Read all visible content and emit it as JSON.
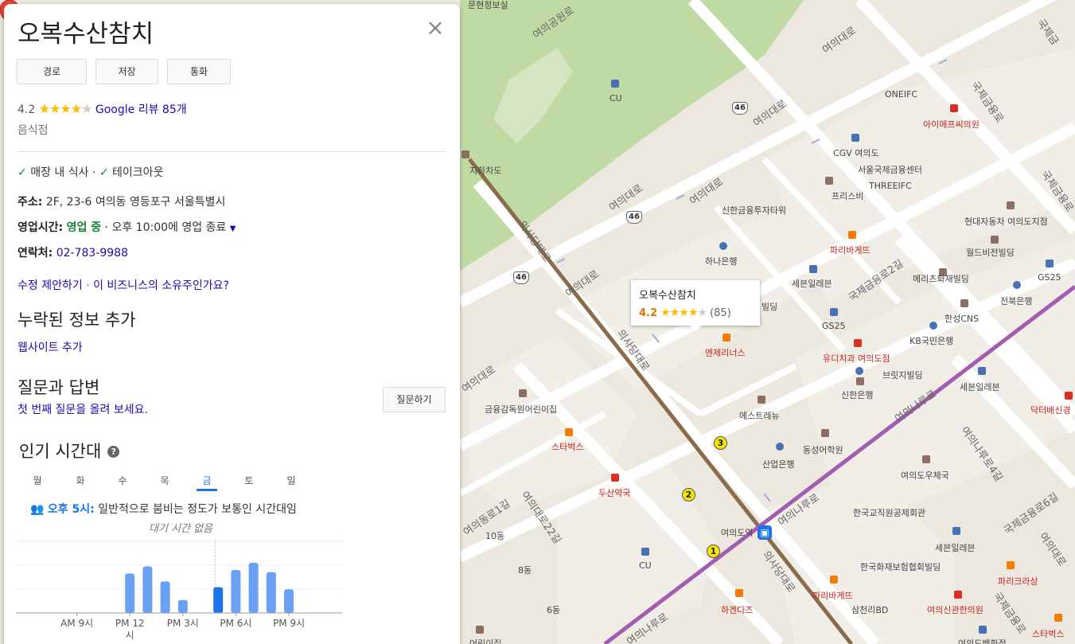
{
  "place": {
    "name": "오복수산참치",
    "actions": [
      "경로",
      "저장",
      "통화"
    ],
    "rating": "4.2",
    "review_link": "Google 리뷰 85개",
    "category": "음식점",
    "services": [
      "매장 내 식사",
      "테이크아웃"
    ],
    "service_sep": "·",
    "address_label": "주소:",
    "address": "2F, 23-6 여의동 영등포구 서울특별시",
    "hours_label": "영업시간:",
    "hours_status": "영업 중",
    "hours_detail": "· 오후 10:00에 영업 종료",
    "phone_label": "연락처:",
    "phone": "02-783-9988",
    "suggest_edit": "수정 제안하기",
    "owner_link": "이 비즈니스의 소유주인가요?",
    "link_sep": "·",
    "missing_title": "누락된 정보 추가",
    "add_website": "웹사이트 추가",
    "qa_title": "질문과 답변",
    "qa_prompt": "첫 번째 질문을 올려 보세요.",
    "ask_button": "질문하기",
    "popular_title": "인기 시간대",
    "help_icon": "?",
    "close_icon": "×"
  },
  "popular_times": {
    "days": [
      "월",
      "화",
      "수",
      "목",
      "금",
      "토",
      "일"
    ],
    "selected_day": "금",
    "time_highlight": "오후 5시:",
    "busy_text": "일반적으로 붐비는 정도가 보통인 시간대임",
    "wait_text": "대기 시간 없음",
    "colors": {
      "bar": "#6aa1f5",
      "current": "#1a73e8"
    }
  },
  "chart_data": {
    "type": "bar",
    "tick_labels": [
      "AM 9시",
      "PM 12\n시",
      "PM 3시",
      "PM 6시",
      "PM 9시"
    ],
    "hours": [
      18,
      19,
      20,
      21,
      22,
      23,
      24
    ],
    "bars_before": [
      {
        "hour": 12,
        "value": 55
      },
      {
        "hour": 13,
        "value": 65
      },
      {
        "hour": 14,
        "value": 44
      },
      {
        "hour": 15,
        "value": 18
      }
    ],
    "bars_after": [
      {
        "hour": 17,
        "value": 36,
        "current": true
      },
      {
        "hour": 18,
        "value": 60
      },
      {
        "hour": 19,
        "value": 70
      },
      {
        "hour": 20,
        "value": 57
      },
      {
        "hour": 21,
        "value": 33
      }
    ],
    "ylim": [
      0,
      100
    ]
  },
  "map": {
    "popup_title": "오복수산참치",
    "popup_rating": "4.2",
    "popup_count": "(85)",
    "labels": [
      {
        "text": "문현정보실",
        "cls": ""
      },
      {
        "text": "ONEIFC",
        "cls": ""
      },
      {
        "text": "아이에프씨의원",
        "cls": "red"
      },
      {
        "text": "CGV 여의도",
        "cls": ""
      },
      {
        "text": "서울국제금융센터",
        "cls": ""
      },
      {
        "text": "THREEIFC",
        "cls": ""
      },
      {
        "text": "프리스비",
        "cls": ""
      },
      {
        "text": "CU",
        "cls": ""
      },
      {
        "text": "신한금융투자타워",
        "cls": ""
      },
      {
        "text": "현대자동차 여의도지점",
        "cls": ""
      },
      {
        "text": "파리바게뜨",
        "cls": "red"
      },
      {
        "text": "월드비전빌딩",
        "cls": ""
      },
      {
        "text": "하나은행",
        "cls": ""
      },
      {
        "text": "세븐일레븐",
        "cls": ""
      },
      {
        "text": "메리츠화재빌딩",
        "cls": ""
      },
      {
        "text": "GS25",
        "cls": ""
      },
      {
        "text": "전북은행",
        "cls": ""
      },
      {
        "text": "빌딩",
        "cls": ""
      },
      {
        "text": "GS25",
        "cls": ""
      },
      {
        "text": "한성CNS",
        "cls": ""
      },
      {
        "text": "엔제리너스",
        "cls": "red"
      },
      {
        "text": "유디치과 여의도점",
        "cls": "red"
      },
      {
        "text": "KB국민은행",
        "cls": ""
      },
      {
        "text": "브릿지빌딩",
        "cls": ""
      },
      {
        "text": "신한은행",
        "cls": ""
      },
      {
        "text": "세븐일레븐",
        "cls": ""
      },
      {
        "text": "금융감독원어린이집",
        "cls": ""
      },
      {
        "text": "에스트레뉴",
        "cls": ""
      },
      {
        "text": "닥터배신경",
        "cls": "red"
      },
      {
        "text": "스타벅스",
        "cls": "red"
      },
      {
        "text": "동성어학원",
        "cls": ""
      },
      {
        "text": "산업은행",
        "cls": ""
      },
      {
        "text": "여의도우체국",
        "cls": ""
      },
      {
        "text": "두산약국",
        "cls": "red"
      },
      {
        "text": "한국교직원공제회관",
        "cls": ""
      },
      {
        "text": "여의도역",
        "cls": ""
      },
      {
        "text": "10동",
        "cls": ""
      },
      {
        "text": "세븐일레븐",
        "cls": ""
      },
      {
        "text": "CU",
        "cls": ""
      },
      {
        "text": "8동",
        "cls": ""
      },
      {
        "text": "한국화재보험협회빌딩",
        "cls": ""
      },
      {
        "text": "파리크라상",
        "cls": "red"
      },
      {
        "text": "파리바게뜨",
        "cls": "red"
      },
      {
        "text": "하겐다즈",
        "cls": "red"
      },
      {
        "text": "6동",
        "cls": ""
      },
      {
        "text": "삼천리BD",
        "cls": ""
      },
      {
        "text": "여의신관한의원",
        "cls": "red"
      },
      {
        "text": "스타벅스",
        "cls": "red"
      },
      {
        "text": "여의도백화점",
        "cls": ""
      },
      {
        "text": "어린이집",
        "cls": ""
      },
      {
        "text": "지하차도",
        "cls": ""
      }
    ],
    "roads": [
      "여의공원로",
      "여의대로",
      "여의대로",
      "여의대로",
      "여의대로",
      "여의대로",
      "여의대로",
      "국제금융로",
      "국제금융로2길",
      "의사당대로",
      "의사당대로",
      "의사당대로",
      "여의나루로",
      "여의나루로",
      "여의나루로",
      "여의나루로4길",
      "국제금융로6길",
      "국제금융로",
      "여의대로22길",
      "여의동로1길",
      "여의대로",
      "국제금융로",
      "국제금"
    ],
    "shields": [
      "46",
      "46",
      "46"
    ],
    "metro": [
      "3",
      "2",
      "1"
    ]
  }
}
